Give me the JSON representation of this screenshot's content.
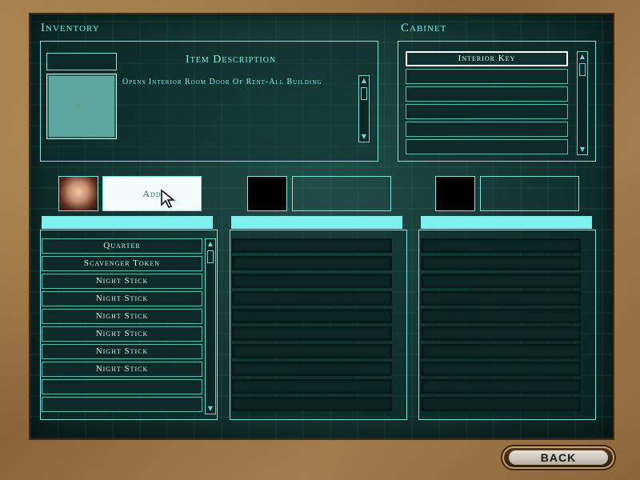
{
  "titles": {
    "inventory": "Inventory",
    "cabinet": "Cabinet"
  },
  "item_panel": {
    "heading": "Item Description",
    "description": "Opens Interior Room Door Of Rent-All Building"
  },
  "cabinet": {
    "items": [
      "Interior Key",
      "",
      "",
      "",
      "",
      ""
    ]
  },
  "transfer": {
    "add_label": "Add"
  },
  "player_list": {
    "items": [
      "Quarter",
      "Scavenger Token",
      "Night Stick",
      "Night Stick",
      "Night Stick",
      "Night Stick",
      "Night Stick",
      "Night Stick",
      "",
      ""
    ]
  },
  "back_label": "BACK",
  "colors": {
    "accent": "#7ff0f0",
    "frame": "#a17b4b",
    "screen": "#10302c"
  }
}
